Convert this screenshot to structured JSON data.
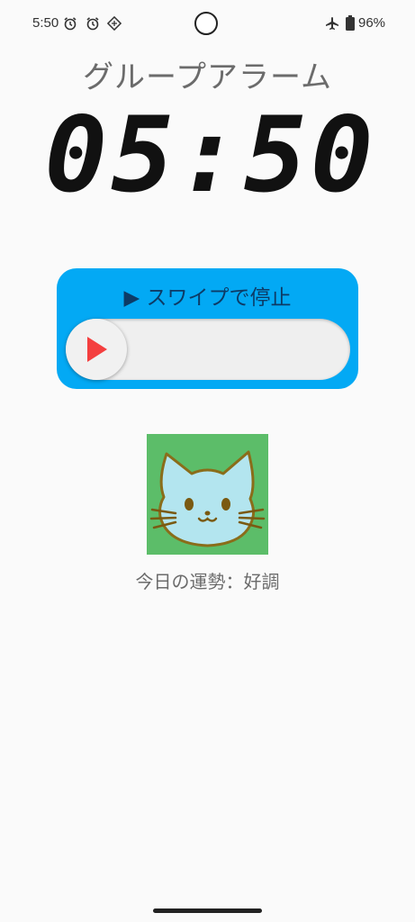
{
  "status_bar": {
    "time": "5:50",
    "battery": "96%",
    "icons": [
      "alarm-icon",
      "alarm-icon",
      "app-notification-icon",
      "airplane-mode-icon",
      "battery-icon"
    ]
  },
  "title": "グループアラーム",
  "clock": {
    "time": "05:50"
  },
  "swipe": {
    "label": "▶ スワイプで停止",
    "thumb_icon": "play-icon"
  },
  "fortune": {
    "image_icon": "cat-face-icon",
    "text": "今日の運勢：好調"
  },
  "colors": {
    "background": "#fafafa",
    "accent_blue": "#03a9f4",
    "play_red": "#f43f3f",
    "cat_bg": "#5cbd69",
    "cat_face": "#b3e5ef",
    "cat_outline": "#8a6d1a"
  }
}
